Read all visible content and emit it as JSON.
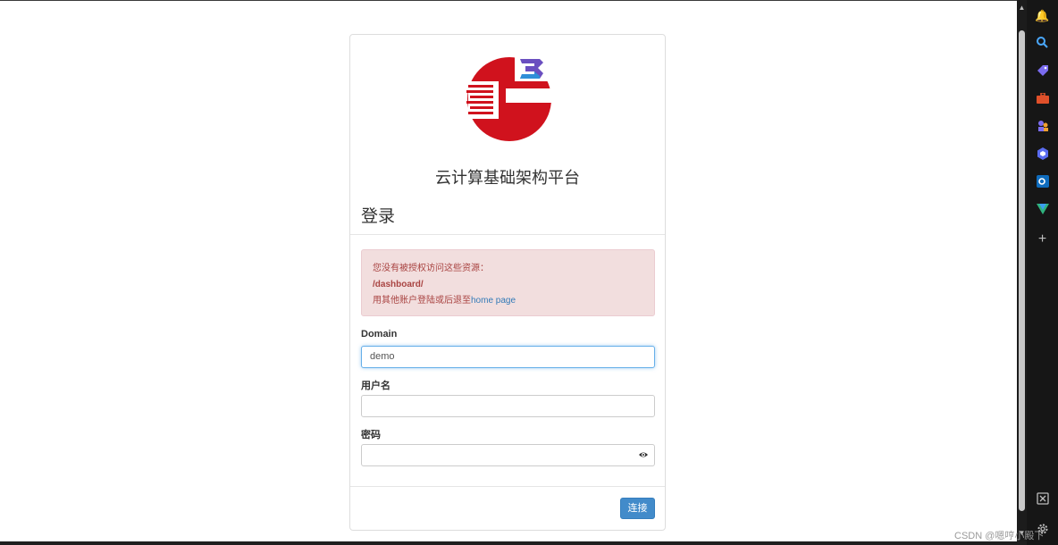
{
  "brand": {
    "title": "云计算基础架构平台"
  },
  "login": {
    "title": "登录"
  },
  "alert": {
    "line1": "您没有被授权访问这些资源：",
    "path": "/dashboard/",
    "line3_prefix": "用其他账户登陆或后退至",
    "home_link": "home page"
  },
  "form": {
    "domain_label": "Domain",
    "domain_value": "demo",
    "username_label": "用户名",
    "username_value": "",
    "password_label": "密码",
    "password_value": ""
  },
  "actions": {
    "connect_label": "连接"
  },
  "watermark": "CSDN @嗯哼小殿下",
  "colors": {
    "accent": "#428bca",
    "alert_bg": "#f2dede",
    "alert_text": "#a94442",
    "link": "#337ab7"
  }
}
